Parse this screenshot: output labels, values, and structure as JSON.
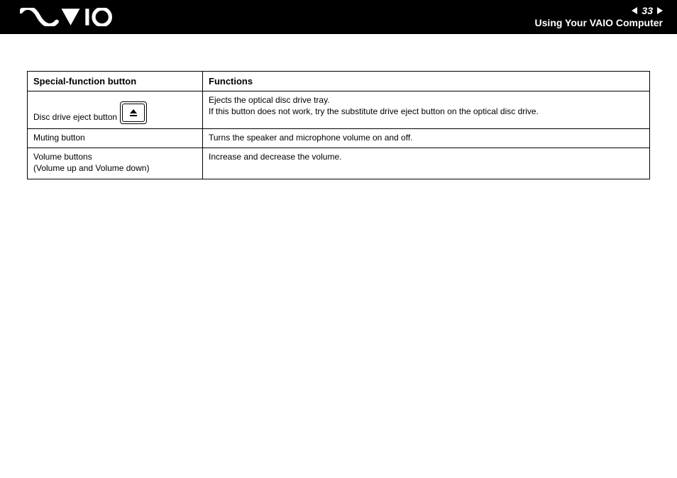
{
  "header": {
    "page_number": "33",
    "section_title": "Using Your VAIO Computer"
  },
  "table": {
    "col1_header": "Special-function button",
    "col2_header": "Functions",
    "rows": [
      {
        "label": "Disc drive eject button",
        "icon": "eject-icon",
        "func_line1": "Ejects the optical disc drive tray.",
        "func_line2": "If this button does not work, try the substitute drive eject button on the optical disc drive."
      },
      {
        "label": "Muting button",
        "func": "Turns the speaker and microphone volume on and off."
      },
      {
        "label_line1": "Volume buttons",
        "label_line2": "(Volume up and Volume down)",
        "func": "Increase and decrease the volume."
      }
    ]
  }
}
